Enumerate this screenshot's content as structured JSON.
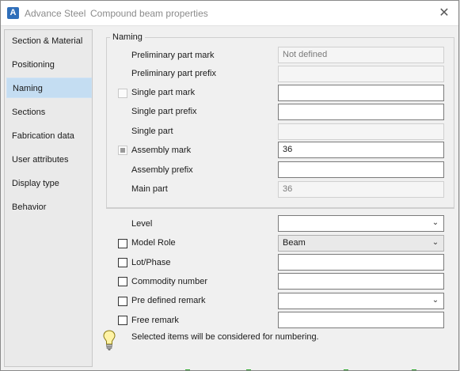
{
  "window": {
    "app_name": "Advance Steel",
    "title": "Compound beam properties",
    "logo_letter": "A"
  },
  "sidebar": {
    "items": [
      {
        "label": "Section & Material"
      },
      {
        "label": "Positioning"
      },
      {
        "label": "Naming"
      },
      {
        "label": "Sections"
      },
      {
        "label": "Fabrication data"
      },
      {
        "label": "User attributes"
      },
      {
        "label": "Display type"
      },
      {
        "label": "Behavior"
      }
    ],
    "active": "Naming"
  },
  "naming_group": {
    "legend": "Naming",
    "rows": [
      {
        "label": "Preliminary part mark",
        "value": "Not defined",
        "placeholder": "",
        "checkbox": "none",
        "state": "disabled"
      },
      {
        "label": "Preliminary part prefix",
        "value": "",
        "placeholder": "",
        "checkbox": "none",
        "state": "disabled"
      },
      {
        "label": "Single part mark",
        "value": "",
        "placeholder": "",
        "checkbox": "unchecked",
        "state": "enabled"
      },
      {
        "label": "Single part prefix",
        "value": "",
        "placeholder": "",
        "checkbox": "none",
        "state": "enabled"
      },
      {
        "label": "Single part",
        "value": "",
        "placeholder": "",
        "checkbox": "none",
        "state": "disabled"
      },
      {
        "label": "Assembly mark",
        "value": "36",
        "placeholder": "",
        "checkbox": "indeterminate",
        "state": "enabled"
      },
      {
        "label": "Assembly prefix",
        "value": "",
        "placeholder": "",
        "checkbox": "none",
        "state": "enabled"
      },
      {
        "label": "Main part",
        "value": "36",
        "placeholder": "",
        "checkbox": "none",
        "state": "disabled"
      }
    ]
  },
  "lower": {
    "level": {
      "label": "Level",
      "value": ""
    },
    "model_role": {
      "label": "Model Role",
      "value": "Beam"
    },
    "lot_phase": {
      "label": "Lot/Phase",
      "value": ""
    },
    "commodity_number": {
      "label": "Commodity number",
      "value": ""
    },
    "pre_defined_remark": {
      "label": "Pre defined remark",
      "value": ""
    },
    "free_remark": {
      "label": "Free remark",
      "value": ""
    }
  },
  "hint": {
    "text": "Selected items will be considered for numbering.",
    "icon": "lightbulb-icon"
  },
  "colors": {
    "active_tab": "#c4ddf2",
    "logo": "#2f6fba"
  }
}
